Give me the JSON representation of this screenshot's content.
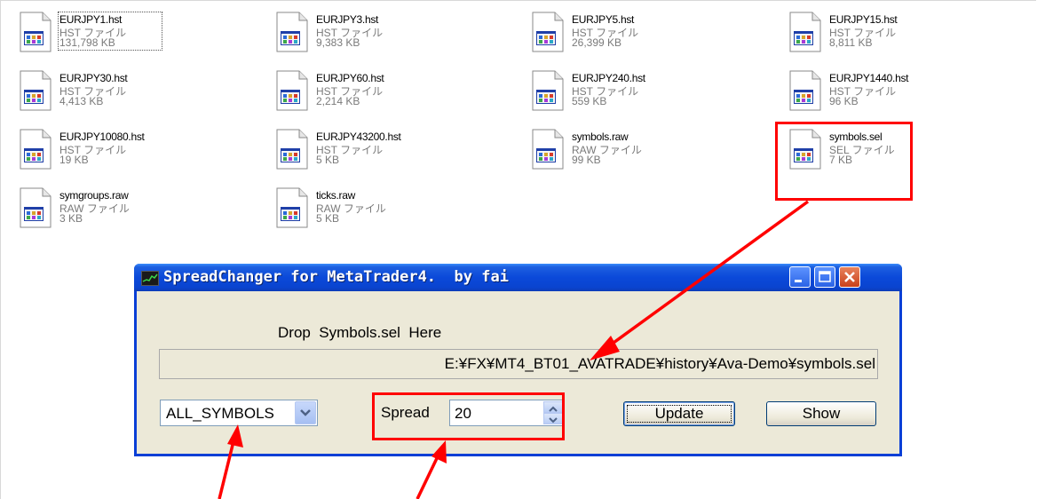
{
  "files": [
    {
      "name": "EURJPY1.hst",
      "type": "HST ファイル",
      "size": "131,798 KB",
      "selected": true
    },
    {
      "name": "EURJPY3.hst",
      "type": "HST ファイル",
      "size": "9,383 KB"
    },
    {
      "name": "EURJPY5.hst",
      "type": "HST ファイル",
      "size": "26,399 KB"
    },
    {
      "name": "EURJPY15.hst",
      "type": "HST ファイル",
      "size": "8,811 KB"
    },
    {
      "name": "EURJPY30.hst",
      "type": "HST ファイル",
      "size": "4,413 KB"
    },
    {
      "name": "EURJPY60.hst",
      "type": "HST ファイル",
      "size": "2,214 KB"
    },
    {
      "name": "EURJPY240.hst",
      "type": "HST ファイル",
      "size": "559 KB"
    },
    {
      "name": "EURJPY1440.hst",
      "type": "HST ファイル",
      "size": "96 KB"
    },
    {
      "name": "EURJPY10080.hst",
      "type": "HST ファイル",
      "size": "19 KB"
    },
    {
      "name": "EURJPY43200.hst",
      "type": "HST ファイル",
      "size": "5 KB"
    },
    {
      "name": "symbols.raw",
      "type": "RAW ファイル",
      "size": "99 KB"
    },
    {
      "name": "symbols.sel",
      "type": "SEL ファイル",
      "size": "7 KB"
    },
    {
      "name": "symgroups.raw",
      "type": "RAW ファイル",
      "size": "3 KB"
    },
    {
      "name": "ticks.raw",
      "type": "RAW ファイル",
      "size": "5 KB"
    }
  ],
  "dialog": {
    "title": "SpreadChanger for MetaTrader4.  by fai",
    "drop_label": "Drop  Symbols.sel  Here",
    "path": "E:¥FX¥MT4_BT01_AVATRADE¥history¥Ava-Demo¥symbols.sel",
    "symbol_select": "ALL_SYMBOLS",
    "spread_label": "Spread",
    "spread_value": "20",
    "update_label": "Update",
    "show_label": "Show"
  },
  "colors": {
    "annotation": "#ff0000",
    "titlebar": "#0a44d0",
    "dialog_bg": "#ece9d8"
  }
}
